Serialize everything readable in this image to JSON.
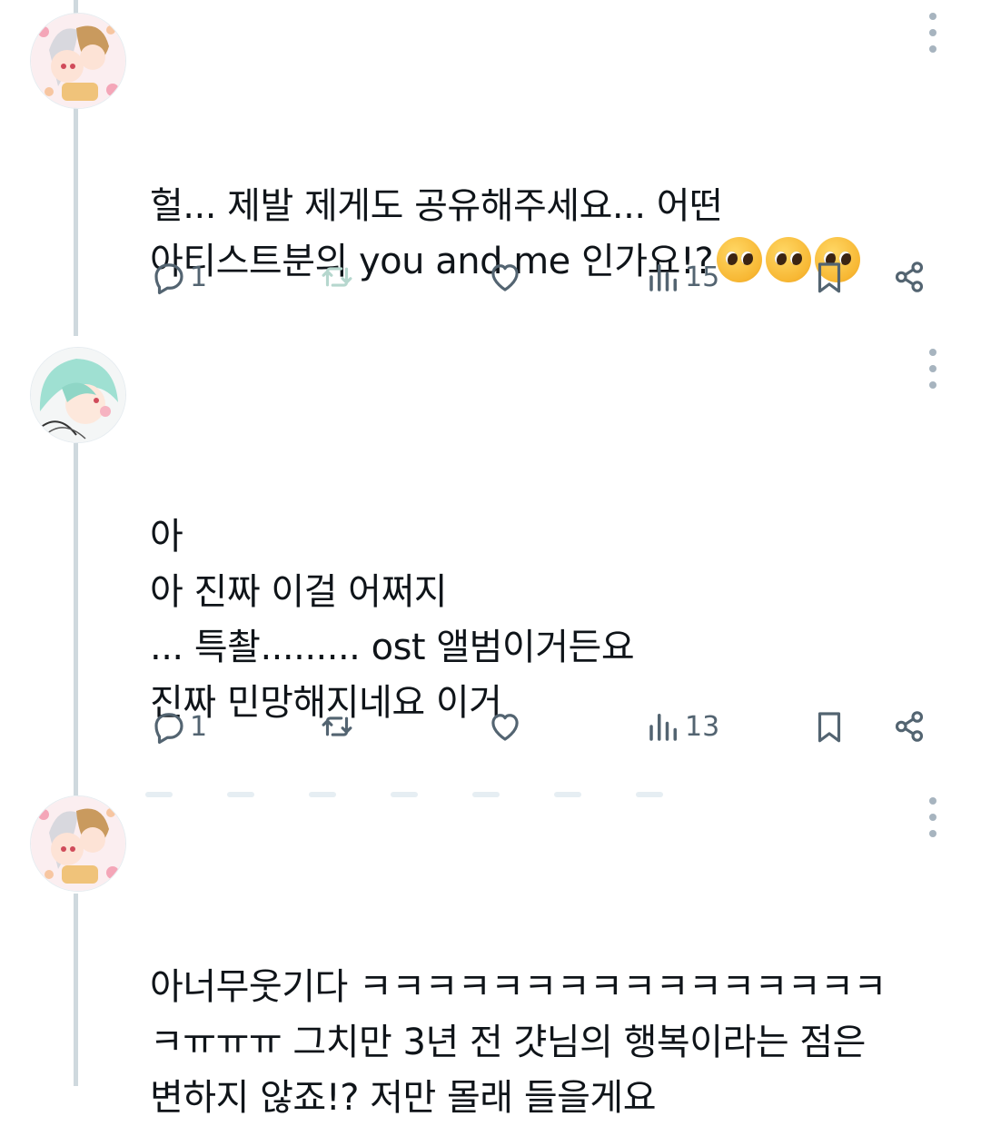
{
  "tweets": [
    {
      "text": "헐... 제발 제게도 공유해주세요... 어떤\n아티스트분의 you and me 인가요!?",
      "emoji": [
        "pleading-face",
        "pleading-face",
        "pleading-face"
      ],
      "replies": "1",
      "views": "15"
    },
    {
      "text": "아\n아 진짜 이걸 어쩌지\n... 특촬......... ost 앨범이거든요\n진짜 민망해지네요 이거",
      "replies": "1",
      "views": "13"
    },
    {
      "text": "아너무웃기다 ㅋㅋㅋㅋㅋㅋㅋㅋㅋㅋㅋㅋㅋㅋㅋㅋ\nㅋㅠㅠㅠ 그치만 3년 전 걋님의 행복이라는 점은\n변하지 않죠!? 저만 몰래 들을게요"
    }
  ],
  "colors": {
    "text": "#0f1419",
    "secondary": "#536471",
    "retweet_active": "#00ba7c",
    "thread_line": "#cfd9de"
  }
}
